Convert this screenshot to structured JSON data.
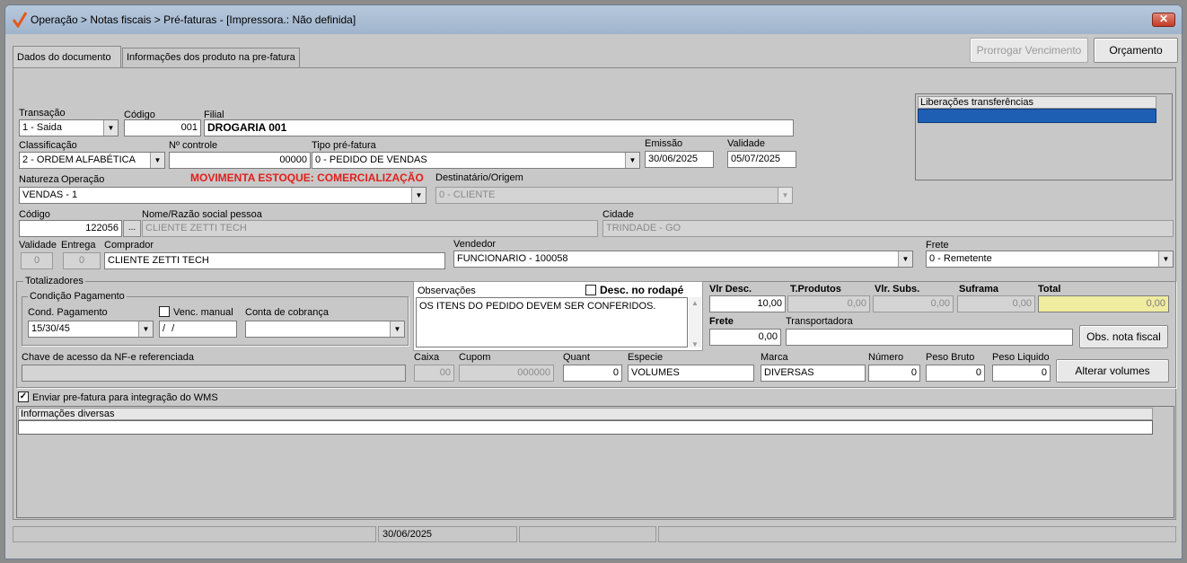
{
  "window": {
    "title": "Operação > Notas fiscais > Pré-faturas - [Impressora.: Não definida]",
    "close": "✕"
  },
  "toolbar": {
    "prorrogar": "Prorrogar Vencimento",
    "orcamento": "Orçamento"
  },
  "tabs": [
    "Dados do documento",
    "Informações dos produto na pre-fatura"
  ],
  "fields": {
    "transacao": {
      "label": "Transação",
      "value": "1 - Saida"
    },
    "codigo": {
      "label": "Código",
      "value": "001"
    },
    "filial": {
      "label": "Filial",
      "value": "DROGARIA 001"
    },
    "classificacao": {
      "label": "Classificação",
      "value": "2 - ORDEM ALFABÉTICA"
    },
    "n_controle": {
      "label": "Nº controle",
      "value": "00000"
    },
    "tipo_prefatura": {
      "label": "Tipo pré-fatura",
      "value": "0 - PEDIDO DE VENDAS"
    },
    "emissao": {
      "label": "Emissão",
      "value": "30/06/2025"
    },
    "validade": {
      "label": "Validade",
      "value": "05/07/2025"
    },
    "natureza": {
      "label": "Natureza",
      "label2": "Operação",
      "value": "VENDAS - 1"
    },
    "movimenta": "MOVIMENTA ESTOQUE: COMERCIALIZAÇÃO",
    "destinatario": {
      "label": "Destinatário/Origem",
      "value": "0 - CLIENTE"
    },
    "codigo_pessoa": {
      "label": "Código",
      "value": "122056",
      "btn": "..."
    },
    "nome": {
      "label": "Nome/Razão social pessoa",
      "value": "CLIENTE ZETTI TECH"
    },
    "cidade": {
      "label": "Cidade",
      "value": "TRINDADE - GO"
    },
    "validade2": {
      "label": "Validade",
      "value": "0"
    },
    "entrega": {
      "label": "Entrega",
      "value": "0"
    },
    "comprador": {
      "label": "Comprador",
      "value": "CLIENTE ZETTI TECH"
    },
    "vendedor": {
      "label": "Vendedor",
      "value": "FUNCIONARIO - 100058"
    },
    "frete": {
      "label": "Frete",
      "value": "0 - Remetente"
    }
  },
  "liberacoes": {
    "header": "Liberações transferências"
  },
  "totalizadores": {
    "title": "Totalizadores",
    "condicao": {
      "title": "Condição Pagamento",
      "cond_label": "Cond. Pagamento",
      "cond_value": "15/30/45",
      "venc_label": "Venc. manual",
      "venc_value": "/ /",
      "conta_label": "Conta de cobrança",
      "conta_value": ""
    },
    "observacoes": {
      "label": "Observações",
      "desc_label": "Desc. no rodapé",
      "text": "OS ITENS DO PEDIDO DEVEM SER CONFERIDOS."
    },
    "vlr_desc": {
      "label": "Vlr Desc.",
      "value": "10,00"
    },
    "t_produtos": {
      "label": "T.Produtos",
      "value": "0,00"
    },
    "vlr_subs": {
      "label": "Vlr. Subs.",
      "value": "0,00"
    },
    "suframa": {
      "label": "Suframa",
      "value": "0,00"
    },
    "total": {
      "label": "Total",
      "value": "0,00"
    },
    "frete": {
      "label": "Frete",
      "value": "0,00"
    },
    "transportadora": {
      "label": "Transportadora",
      "value": ""
    },
    "obs_btn": "Obs. nota fiscal",
    "chave_label": "Chave de acesso da NF-e referenciada",
    "caixa": {
      "label": "Caixa",
      "value": "00"
    },
    "cupom": {
      "label": "Cupom",
      "value": "000000"
    },
    "quant": {
      "label": "Quant",
      "value": "0"
    },
    "especie": {
      "label": "Especie",
      "value": "VOLUMES"
    },
    "marca": {
      "label": "Marca",
      "value": "DIVERSAS"
    },
    "numero": {
      "label": "Número",
      "value": "0"
    },
    "peso_bruto": {
      "label": "Peso Bruto",
      "value": "0"
    },
    "peso_liquido": {
      "label": "Peso Liquido",
      "value": "0"
    },
    "alterar_btn": "Alterar volumes"
  },
  "wms": {
    "label": "Enviar pre-fatura para integração do WMS",
    "checked": "✓"
  },
  "info": {
    "header": "Informações diversas"
  },
  "status": {
    "date": "30/06/2025"
  },
  "colors": {
    "title_bg": "#a9bdd4",
    "total_bg": "#f0eca0",
    "movimenta": "#e0201e",
    "selected_row": "#1e5fb4"
  }
}
